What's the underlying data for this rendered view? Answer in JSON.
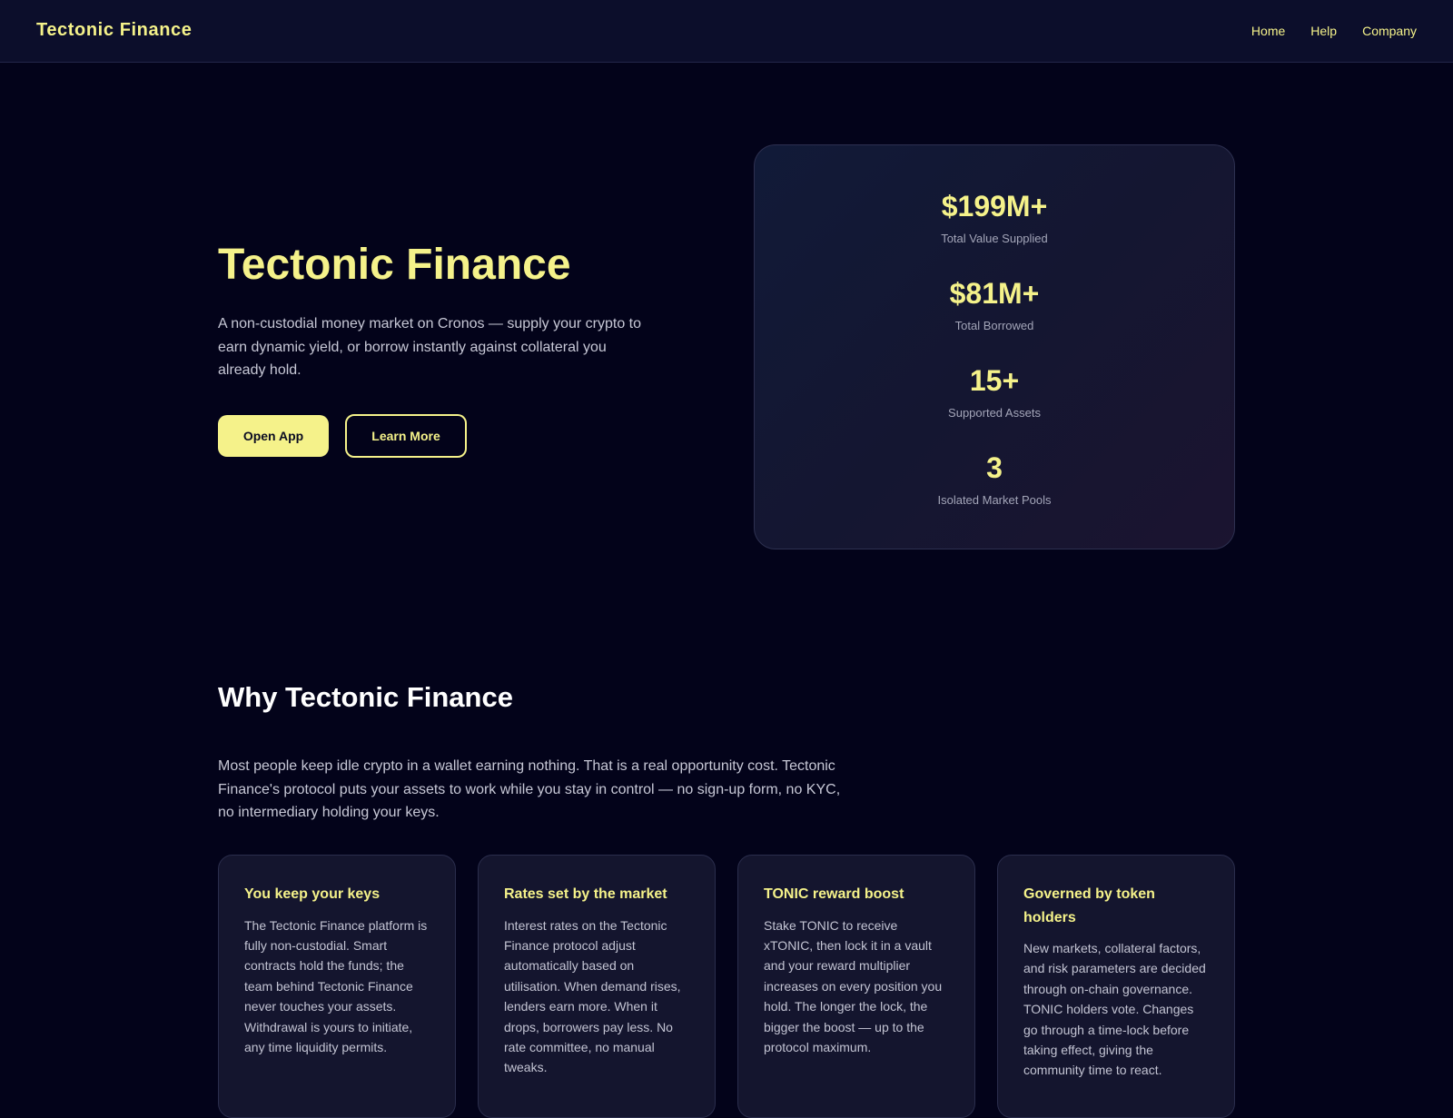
{
  "header": {
    "brand": "Tectonic Finance",
    "nav": [
      "Home",
      "Help",
      "Company"
    ]
  },
  "hero": {
    "title": "Tectonic Finance",
    "description": "A non-custodial money market on Cronos — supply your crypto to earn dynamic yield, or borrow instantly against collateral you already hold.",
    "primary_button": "Open App",
    "secondary_button": "Learn More"
  },
  "stats": [
    {
      "value": "$199M+",
      "label": "Total Value Supplied"
    },
    {
      "value": "$81M+",
      "label": "Total Borrowed"
    },
    {
      "value": "15+",
      "label": "Supported Assets"
    },
    {
      "value": "3",
      "label": "Isolated Market Pools"
    }
  ],
  "why": {
    "title": "Why Tectonic Finance",
    "description": "Most people keep idle crypto in a wallet earning nothing. That is a real opportunity cost. Tectonic Finance's protocol puts your assets to work while you stay in control — no sign-up form, no KYC, no intermediary holding your keys.",
    "features": [
      {
        "title": "You keep your keys",
        "body": "The Tectonic Finance platform is fully non-custodial. Smart contracts hold the funds; the team behind Tectonic Finance never touches your assets. Withdrawal is yours to initiate, any time liquidity permits."
      },
      {
        "title": "Rates set by the market",
        "body": "Interest rates on the Tectonic Finance protocol adjust automatically based on utilisation. When demand rises, lenders earn more. When it drops, borrowers pay less. No rate committee, no manual tweaks."
      },
      {
        "title": "TONIC reward boost",
        "body": "Stake TONIC to receive xTONIC, then lock it in a vault and your reward multiplier increases on every position you hold. The longer the lock, the bigger the boost — up to the protocol maximum."
      },
      {
        "title": "Governed by token holders",
        "body": "New markets, collateral factors, and risk parameters are decided through on-chain governance. TONIC holders vote. Changes go through a time-lock before taking effect, giving the community time to react."
      }
    ]
  },
  "colors": {
    "accent": "#f5f28a",
    "background": "#03031a",
    "header": "#0c0e2b",
    "card": "#14152e"
  }
}
